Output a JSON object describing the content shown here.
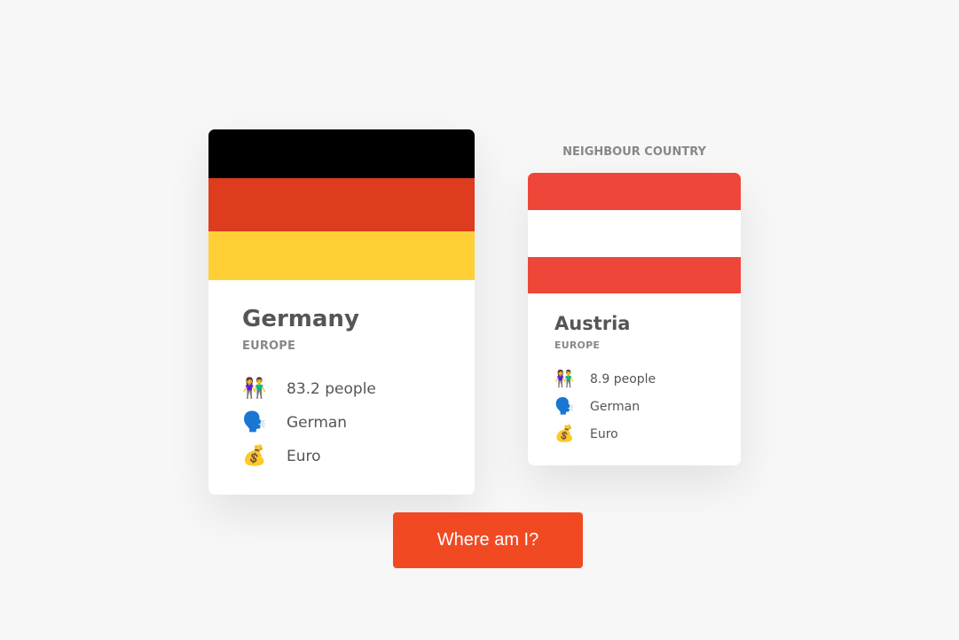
{
  "main_country": {
    "name": "Germany",
    "region": "EUROPE",
    "population": "83.2 people",
    "language": "German",
    "currency": "Euro",
    "flag_colors": [
      "#000000",
      "#dd3c1f",
      "#fed035"
    ],
    "population_icon": "people-holding-hands-icon",
    "language_icon": "speaking-head-icon",
    "currency_icon": "money-bag-icon"
  },
  "neighbour_label": "NEIGHBOUR COUNTRY",
  "neighbour_country": {
    "name": "Austria",
    "region": "EUROPE",
    "population": "8.9 people",
    "language": "German",
    "currency": "Euro",
    "flag_colors": [
      "#ef463a",
      "#ffffff",
      "#ef463a"
    ],
    "population_icon": "people-holding-hands-icon",
    "language_icon": "speaking-head-icon",
    "currency_icon": "money-bag-icon"
  },
  "button": {
    "label": "Where am I?",
    "color": "#f14a23"
  }
}
